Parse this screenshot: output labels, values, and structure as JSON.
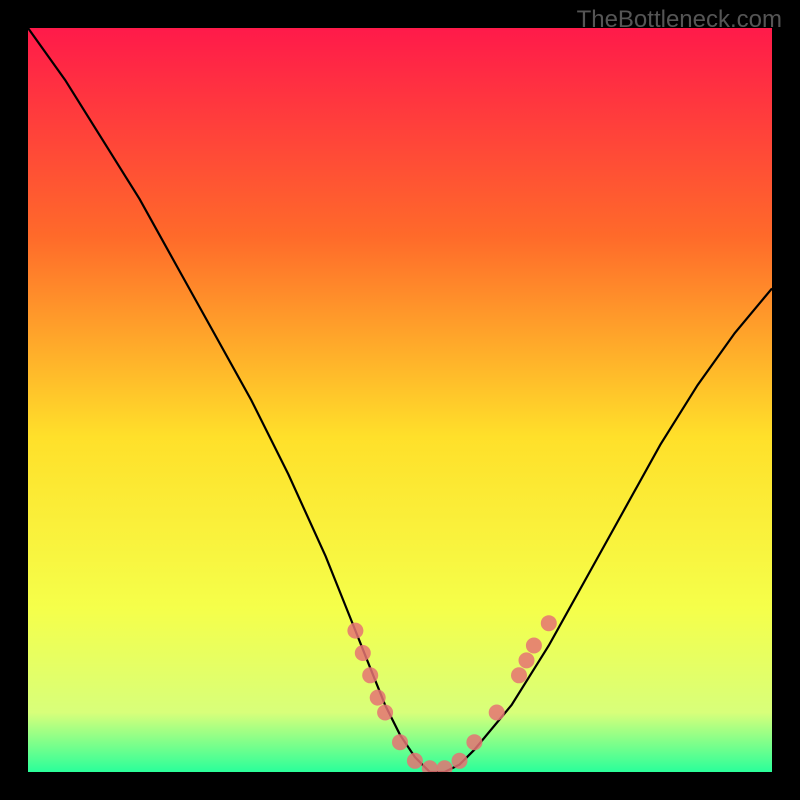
{
  "watermark": "TheBottleneck.com",
  "chart_data": {
    "type": "line",
    "title": "",
    "xlabel": "",
    "ylabel": "",
    "xlim": [
      0,
      100
    ],
    "ylim": [
      0,
      100
    ],
    "background_gradient": {
      "top": "#ff1a4a",
      "upper_mid": "#ff8a2a",
      "mid": "#ffe02a",
      "lower_mid": "#f7ff5a",
      "bottom": "#2aff9a"
    },
    "series": [
      {
        "name": "curve",
        "x": [
          0,
          5,
          10,
          15,
          20,
          25,
          30,
          35,
          40,
          42,
          44,
          46,
          48,
          50,
          52,
          54,
          56,
          58,
          60,
          65,
          70,
          75,
          80,
          85,
          90,
          95,
          100
        ],
        "y": [
          100,
          93,
          85,
          77,
          68,
          59,
          50,
          40,
          29,
          24,
          19,
          14,
          9,
          5,
          2,
          0,
          0,
          1,
          3,
          9,
          17,
          26,
          35,
          44,
          52,
          59,
          65
        ],
        "color": "#000000"
      }
    ],
    "markers": [
      {
        "name": "dots",
        "color": "#e57373",
        "points": [
          {
            "x": 44,
            "y": 19
          },
          {
            "x": 45,
            "y": 16
          },
          {
            "x": 46,
            "y": 13
          },
          {
            "x": 47,
            "y": 10
          },
          {
            "x": 48,
            "y": 8
          },
          {
            "x": 50,
            "y": 4
          },
          {
            "x": 52,
            "y": 1.5
          },
          {
            "x": 54,
            "y": 0.5
          },
          {
            "x": 56,
            "y": 0.5
          },
          {
            "x": 58,
            "y": 1.5
          },
          {
            "x": 60,
            "y": 4
          },
          {
            "x": 63,
            "y": 8
          },
          {
            "x": 66,
            "y": 13
          },
          {
            "x": 67,
            "y": 15
          },
          {
            "x": 68,
            "y": 17
          },
          {
            "x": 70,
            "y": 20
          }
        ]
      }
    ]
  }
}
